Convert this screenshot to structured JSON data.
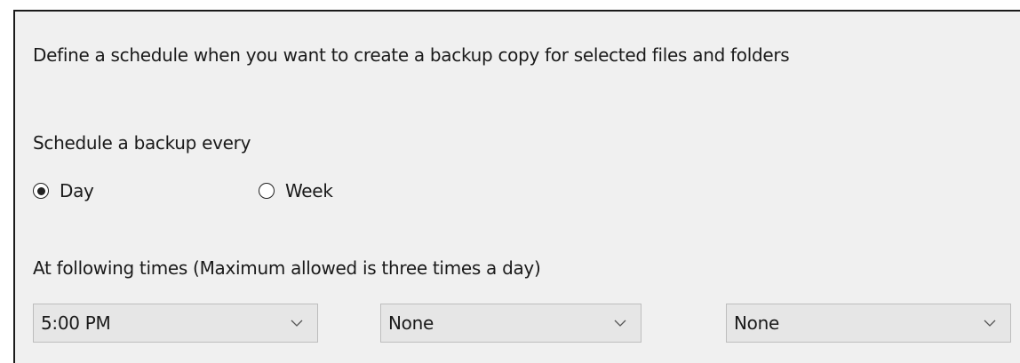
{
  "intro_text": "Define a schedule when you want to create a backup copy for selected files and folders",
  "schedule": {
    "label": "Schedule a backup every",
    "options": [
      {
        "label": "Day",
        "selected": true
      },
      {
        "label": "Week",
        "selected": false
      }
    ]
  },
  "times": {
    "label": "At following times (Maximum allowed is three times a day)",
    "dropdowns": [
      {
        "value": "5:00 PM"
      },
      {
        "value": "None"
      },
      {
        "value": "None"
      }
    ]
  },
  "colors": {
    "panel_background": "#f0f0f0",
    "text": "#1a1a1a",
    "dropdown_background": "#e6e6e6",
    "dropdown_border": "#bdbdbd"
  },
  "icons": {
    "dropdown": "chevron-down-icon",
    "radio_selected": "radio-selected-icon",
    "radio_unselected": "radio-unselected-icon"
  }
}
